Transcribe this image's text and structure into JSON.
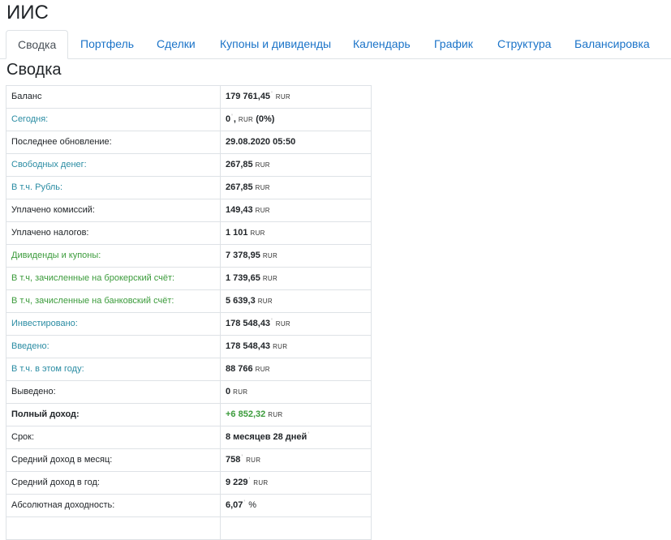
{
  "app": {
    "title": "ИИС"
  },
  "tabs": [
    {
      "label": "Сводка",
      "active": true
    },
    {
      "label": "Портфель"
    },
    {
      "label": "Сделки"
    },
    {
      "label": "Купоны и дивиденды"
    },
    {
      "label": "Календарь"
    },
    {
      "label": "График"
    },
    {
      "label": "Структура"
    },
    {
      "label": "Балансировка"
    }
  ],
  "section": {
    "title": "Сводка"
  },
  "summary": {
    "rows": [
      {
        "label": "Баланс",
        "value": "179 761,45",
        "unit": "RUR"
      },
      {
        "label": "Сегодня:",
        "value": "0",
        "unit": "RUR",
        "extra": "(0%)"
      },
      {
        "label": "Последнее обновление:",
        "value": "29.08.2020 05:50"
      },
      {
        "label": "Свободных денег:",
        "value": "267,85",
        "unit": "RUR"
      },
      {
        "label": "В т.ч. Рубль:",
        "value": "267,85",
        "unit": "RUR"
      },
      {
        "label": "Уплачено комиссий:",
        "value": "149,43",
        "unit": "RUR"
      },
      {
        "label": "Уплачено налогов:",
        "value": "1 101",
        "unit": "RUR"
      },
      {
        "label": "Дивиденды и купоны:",
        "value": "7 378,95",
        "unit": "RUR"
      },
      {
        "label": "В т.ч, зачисленные на брокерский счёт:",
        "value": "1 739,65",
        "unit": "RUR"
      },
      {
        "label": "В т.ч, зачисленные на банковский счёт:",
        "value": "5 639,3",
        "unit": "RUR"
      },
      {
        "label": "Инвестировано:",
        "value": "178 548,43",
        "unit": "RUR"
      },
      {
        "label": "Введено:",
        "value": "178 548,43",
        "unit": "RUR"
      },
      {
        "label": "В т.ч. в этом году:",
        "value": "88 766",
        "unit": "RUR"
      },
      {
        "label": "Выведено:",
        "value": "0",
        "unit": "RUR"
      },
      {
        "label": "Полный доход:",
        "value": "+6 852,32",
        "unit": "RUR"
      },
      {
        "label": "Срок:",
        "value": "8 месяцев 28 дней"
      },
      {
        "label": "Средний доход в месяц:",
        "value": "758",
        "unit": "RUR"
      },
      {
        "label": "Средний доход в год:",
        "value": "9 229",
        "unit": "RUR"
      },
      {
        "label": "Абсолютная доходность:",
        "value": "6,07",
        "unit": "%"
      }
    ]
  },
  "colors": {
    "link": "#1a73c8",
    "teal_label": "#2a8ca3",
    "green_label": "#3b9b3b"
  }
}
